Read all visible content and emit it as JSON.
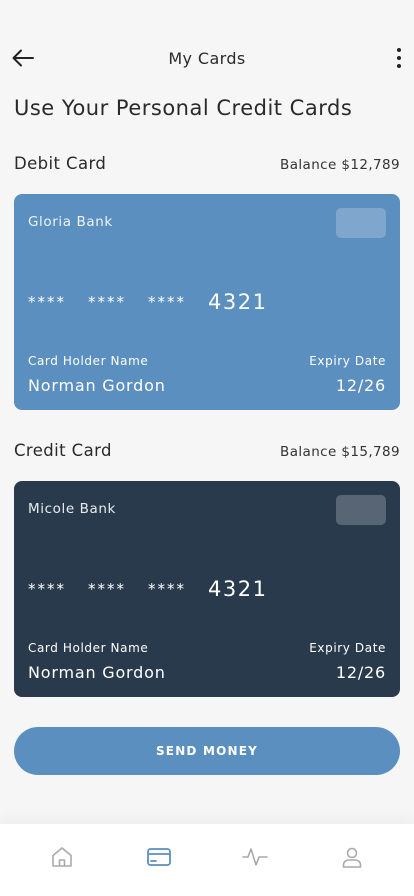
{
  "header": {
    "title": "My Cards",
    "back_icon": "arrow-left-icon",
    "more_icon": "more-vertical-icon"
  },
  "page_heading": "Use Your Personal Credit Cards",
  "sections": [
    {
      "label": "Debit Card",
      "balance": "Balance $12,789",
      "card": {
        "bank": "Gloria Bank",
        "mask_groups": [
          "****",
          "****",
          "****"
        ],
        "last4": "4321",
        "holder_label": "Card Holder Name",
        "holder_name": "Norman Gordon",
        "expiry_label": "Expiry Date",
        "expiry": "12/26",
        "color": "#5b8fbf"
      }
    },
    {
      "label": "Credit Card",
      "balance": "Balance $15,789",
      "card": {
        "bank": "Micole Bank",
        "mask_groups": [
          "****",
          "****",
          "****"
        ],
        "last4": "4321",
        "holder_label": "Card Holder Name",
        "holder_name": "Norman Gordon",
        "expiry_label": "Expiry Date",
        "expiry": "12/26",
        "color": "#2a3a4d"
      }
    }
  ],
  "send_button": {
    "label": "SEND MONEY",
    "color": "#5b8fbf"
  },
  "bottom_nav": {
    "items": [
      {
        "icon": "home-icon",
        "active": false
      },
      {
        "icon": "card-icon",
        "active": true
      },
      {
        "icon": "activity-icon",
        "active": false
      },
      {
        "icon": "user-icon",
        "active": false
      }
    ],
    "active_color": "#5b8fbf",
    "inactive_color": "#a9a9a9"
  }
}
